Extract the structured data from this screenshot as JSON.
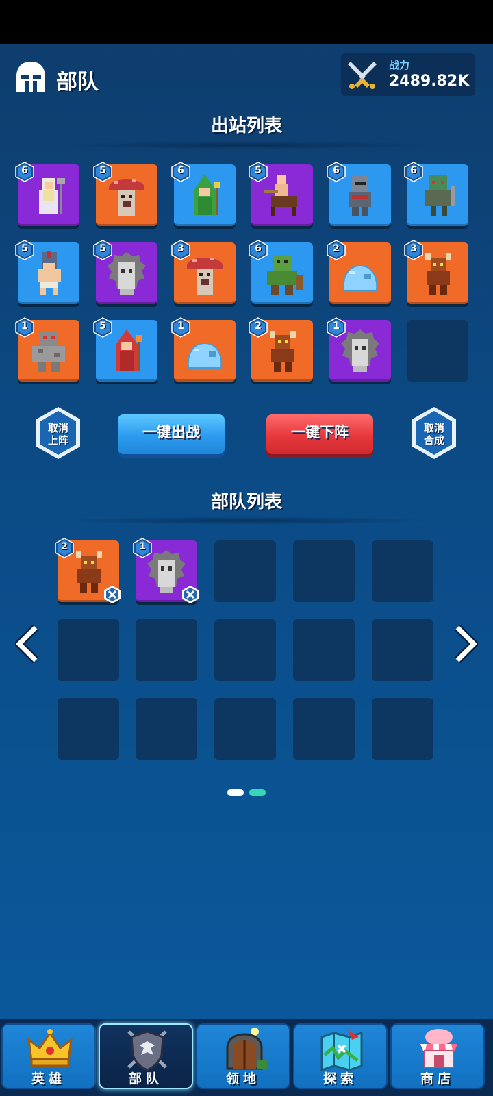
{
  "header": {
    "title": "部队",
    "power_label": "战力",
    "power_value": "2489.82K"
  },
  "deploy_section": {
    "title": "出站列表",
    "cards": [
      {
        "level": "6",
        "color": "purple",
        "unit": "white-mage-icon"
      },
      {
        "level": "5",
        "color": "orange",
        "unit": "mushroom-monster-icon"
      },
      {
        "level": "6",
        "color": "blue",
        "unit": "green-mage-icon"
      },
      {
        "level": "5",
        "color": "purple",
        "unit": "centaur-icon"
      },
      {
        "level": "6",
        "color": "blue",
        "unit": "armored-knight-icon"
      },
      {
        "level": "6",
        "color": "blue",
        "unit": "orc-warrior-icon"
      },
      {
        "level": "5",
        "color": "blue",
        "unit": "gladiator-icon"
      },
      {
        "level": "5",
        "color": "purple",
        "unit": "ghost-spirit-icon"
      },
      {
        "level": "3",
        "color": "orange",
        "unit": "mushroom-monster-icon"
      },
      {
        "level": "6",
        "color": "blue",
        "unit": "green-ogre-icon"
      },
      {
        "level": "2",
        "color": "orange",
        "unit": "slime-icon"
      },
      {
        "level": "3",
        "color": "orange",
        "unit": "minotaur-icon"
      },
      {
        "level": "1",
        "color": "orange",
        "unit": "stone-golem-icon"
      },
      {
        "level": "5",
        "color": "blue",
        "unit": "red-mage-icon"
      },
      {
        "level": "1",
        "color": "orange",
        "unit": "slime-icon"
      },
      {
        "level": "2",
        "color": "orange",
        "unit": "minotaur-icon"
      },
      {
        "level": "1",
        "color": "purple",
        "unit": "ghost-spirit-icon"
      }
    ]
  },
  "actions": {
    "cancel_deploy": "取消上阵",
    "deploy_all": "一键出战",
    "withdraw_all": "一键下阵",
    "cancel_merge": "取消合成"
  },
  "army_section": {
    "title": "部队列表",
    "cards": [
      {
        "level": "2",
        "color": "orange",
        "unit": "minotaur-icon"
      },
      {
        "level": "1",
        "color": "purple",
        "unit": "ghost-spirit-icon"
      }
    ]
  },
  "colors": {
    "orange": "#f06a28",
    "purple": "#8a2ad6",
    "blue": "#2c98f0",
    "empty": "#0d3760",
    "active_dot": "#38d6b8"
  },
  "pager": {
    "current_page": 2,
    "total_pages": 2
  },
  "nav": {
    "items": [
      {
        "label": "英雄",
        "icon": "crown-icon",
        "active": false
      },
      {
        "label": "部队",
        "icon": "eagle-shield-icon",
        "active": true
      },
      {
        "label": "领地",
        "icon": "gate-icon",
        "active": false
      },
      {
        "label": "探索",
        "icon": "map-icon",
        "active": false
      },
      {
        "label": "商店",
        "icon": "shop-icon",
        "active": false
      }
    ]
  }
}
